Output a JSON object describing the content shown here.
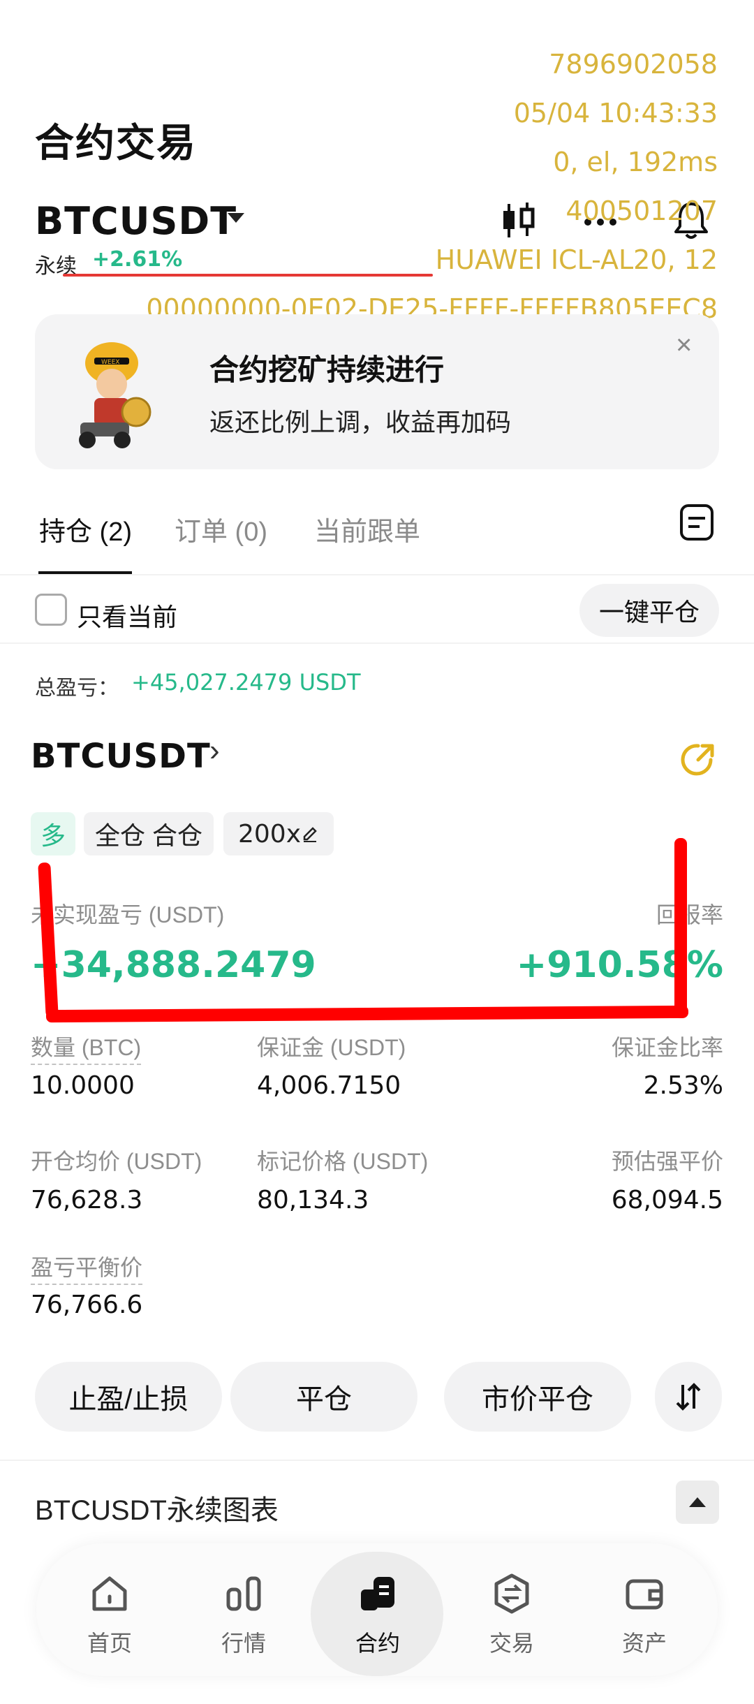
{
  "header": {
    "title": "合约交易",
    "symbol": "BTCUSDT",
    "perp_label": "永续",
    "perp_change": "+2.61%"
  },
  "overlay": {
    "lines": [
      "7896902058",
      "05/04 10:43:33",
      "0, el, 192ms",
      "400501207",
      "HUAWEI ICL-AL20, 12",
      "00000000-0E02-DE25-FFFF-FFFFB805EEC8"
    ]
  },
  "icons": {
    "candles": "candlestick-icon",
    "more": "more-icon",
    "bell": "bell-icon",
    "close": "close-icon",
    "doc": "document-icon",
    "share": "share-icon",
    "swap": "swap-icon"
  },
  "banner": {
    "title": "合约挖矿持续进行",
    "subtitle": "返还比例上调，收益再加码",
    "close": "×",
    "mascot_text": "WEEX"
  },
  "tabs": [
    {
      "label": "持仓 (2)",
      "active": true
    },
    {
      "label": "订单 (0)",
      "active": false
    },
    {
      "label": "当前跟单",
      "active": false
    }
  ],
  "filter": {
    "only_current": "只看当前",
    "close_all": "一键平仓"
  },
  "summary": {
    "total_label": "总盈亏：",
    "total_value": "+45,027.2479 USDT"
  },
  "position": {
    "symbol": "BTCUSDT",
    "chevron": "›",
    "tags": {
      "side": "多",
      "mode": "全仓 合仓",
      "leverage": "200x"
    },
    "unrealized_label": "未实现盈亏 (USDT)",
    "unrealized_value": "+34,888.2479",
    "roe_label": "回报率",
    "roe_value": "+910.58%",
    "fields": {
      "qty_label": "数量 (BTC)",
      "qty_value": "10.0000",
      "margin_label": "保证金 (USDT)",
      "margin_value": "4,006.7150",
      "margin_ratio_label": "保证金比率",
      "margin_ratio_value": "2.53%",
      "entry_label": "开仓均价 (USDT)",
      "entry_value": "76,628.3",
      "mark_label": "标记价格 (USDT)",
      "mark_value": "80,134.3",
      "liq_label": "预估强平价",
      "liq_value": "68,094.5",
      "breakeven_label": "盈亏平衡价",
      "breakeven_value": "76,766.6"
    }
  },
  "actions": {
    "tpsl": "止盈/止损",
    "close": "平仓",
    "market_close": "市价平仓"
  },
  "chart_section": {
    "label": "BTCUSDT永续图表"
  },
  "nav": [
    {
      "label": "首页",
      "icon": "home-icon"
    },
    {
      "label": "行情",
      "icon": "market-icon"
    },
    {
      "label": "合约",
      "icon": "futures-icon",
      "active": true
    },
    {
      "label": "交易",
      "icon": "trade-icon"
    },
    {
      "label": "资产",
      "icon": "wallet-icon"
    }
  ],
  "colors": {
    "green": "#26b98a",
    "overlay_gold": "#d8b43c",
    "red_mark": "#ff0000"
  }
}
